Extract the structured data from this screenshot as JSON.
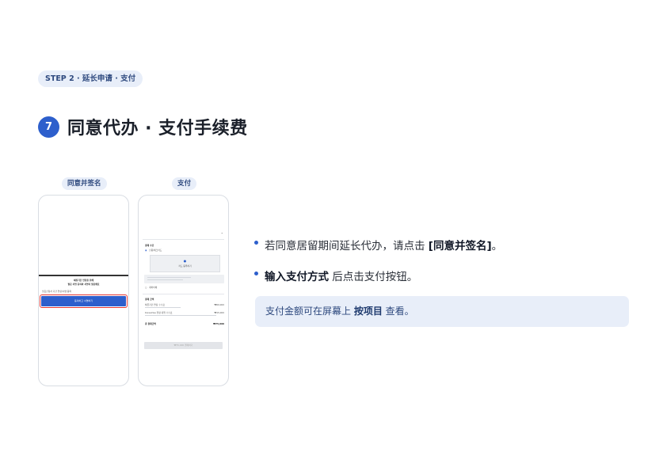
{
  "step_badge": "STEP 2 · 延长申请 · 支付",
  "title": {
    "number": "7",
    "text": "同意代办 · 支付手续费"
  },
  "phones": [
    {
      "label": "同意并签名",
      "text_lines": [
        "체류기간 연장을 위해",
        "필요 서명 동의와 서명이 필요해요"
      ],
      "small_text": "필요신청서 기간 연장/서명 동의",
      "button": "동의하고 서명하기"
    },
    {
      "label": "支付",
      "section_payment": "결제 수단",
      "option_1": "신용/체크카드",
      "box_text": "카드 등록하기",
      "option_2": "계좌이체",
      "section_amount": "결제 금액",
      "row_1": {
        "label": "체류기간 연장 수수료",
        "value": "₩60,000"
      },
      "row_2": {
        "label": "KoreaVisa 행정 대행 수수료",
        "value": "₩15,000"
      },
      "total": {
        "label": "총 결제금액",
        "value": "₩75,000"
      },
      "pay_button": "₩75,000 결제하기"
    }
  ],
  "bullets": [
    {
      "prefix": "若同意居留期间延长代办，请点击 ",
      "bold": "[同意并签名]",
      "suffix": "。"
    },
    {
      "prefix": "",
      "bold": "输入支付方式",
      "suffix": " 后点击支付按钮。"
    }
  ],
  "info": {
    "prefix": "支付金额可在屏幕上 ",
    "bold": "按项目",
    "suffix": " 查看。"
  }
}
